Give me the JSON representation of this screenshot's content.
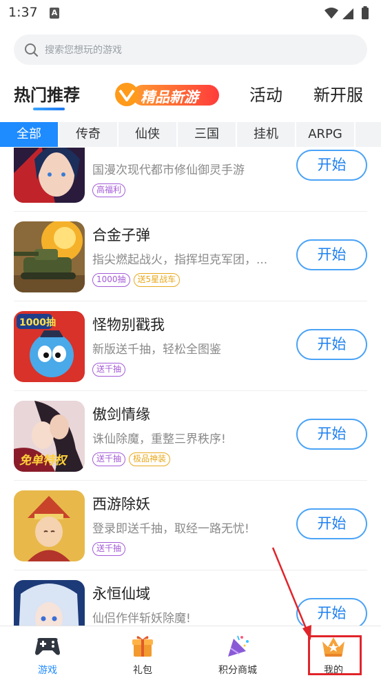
{
  "status_bar": {
    "time": "1:37",
    "notification_icon": "A"
  },
  "search": {
    "placeholder": "搜索您想玩的游戏"
  },
  "main_tabs": [
    {
      "label": "热门推荐",
      "active": true
    },
    {
      "label": "精品新游",
      "featured": true
    },
    {
      "label": "活动"
    },
    {
      "label": "新开服"
    }
  ],
  "category_tabs": [
    {
      "label": "全部",
      "active": true
    },
    {
      "label": "传奇"
    },
    {
      "label": "仙侠"
    },
    {
      "label": "三国"
    },
    {
      "label": "挂机"
    },
    {
      "label": "ARPG"
    }
  ],
  "games": [
    {
      "name": "",
      "desc": "国漫次现代都市修仙御灵手游",
      "tags": [
        {
          "text": "高福利",
          "color": "#a45ad6"
        }
      ],
      "button": "开始"
    },
    {
      "name": "合金子弹",
      "desc": "指尖燃起战火，指挥坦克军团，...",
      "tags": [
        {
          "text": "1000抽",
          "color": "#a45ad6"
        },
        {
          "text": "送5星战车",
          "color": "#e8a81c"
        }
      ],
      "button": "开始"
    },
    {
      "name": "怪物别戳我",
      "desc": "新版送千抽，轻松全图鉴",
      "tags": [
        {
          "text": "送千抽",
          "color": "#a45ad6"
        }
      ],
      "button": "开始"
    },
    {
      "name": "傲剑情缘",
      "desc": "诛仙除魔，重整三界秩序!",
      "tags": [
        {
          "text": "送千抽",
          "color": "#a45ad6"
        },
        {
          "text": "极品神装",
          "color": "#e8a81c"
        }
      ],
      "button": "开始"
    },
    {
      "name": "西游除妖",
      "desc": "登录即送千抽，取经一路无忧!",
      "tags": [
        {
          "text": "送千抽",
          "color": "#a45ad6"
        }
      ],
      "button": "开始"
    },
    {
      "name": "永恒仙域",
      "desc": "仙侣作伴斩妖除魔!",
      "tags": [],
      "button": "开始"
    }
  ],
  "bottom_nav": [
    {
      "label": "游戏",
      "icon": "gamepad-icon",
      "active": true
    },
    {
      "label": "礼包",
      "icon": "gift-icon"
    },
    {
      "label": "积分商城",
      "icon": "party-popper-icon"
    },
    {
      "label": "我的",
      "icon": "crown-icon",
      "highlighted": true
    }
  ],
  "colors": {
    "accent": "#1e8bff",
    "tag_purple": "#a45ad6",
    "tag_gold": "#e8a81c",
    "annotation_red": "#e0242a"
  }
}
